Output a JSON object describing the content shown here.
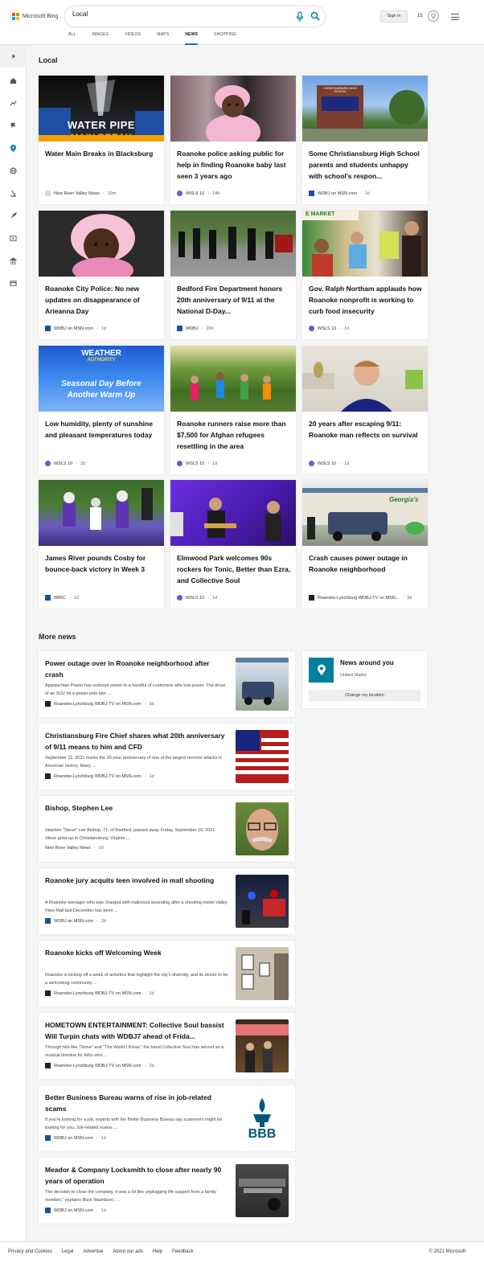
{
  "header": {
    "brand": "Microsoft Bing",
    "search_value": "Local",
    "sign_in": "Sign in",
    "rewards_count": "15"
  },
  "tabs": [
    "ALL",
    "IMAGES",
    "VIDEOS",
    "MAPS",
    "NEWS",
    "SHOPPING"
  ],
  "active_tab": "NEWS",
  "local": {
    "title": "Local",
    "cards": [
      {
        "title": "Water Main Breaks in Blacksburg",
        "source": "New River Valley News",
        "time": "19m"
      },
      {
        "title": "Roanoke police asking public for help in finding Roanoke baby last seen 3 years ago",
        "source": "WSLS 10",
        "time": "14h"
      },
      {
        "title": "Some Christiansburg High School parents and students unhappy with school's respon...",
        "source": "WDBJ on MSN.com",
        "time": "1d"
      },
      {
        "title": "Roanoke City Police: No new updates on disappearance of Arieanna Day",
        "source": "WDBJ on MSN.com",
        "time": "1d"
      },
      {
        "title": "Bedford Fire Department honors 20th anniversary of 9/11 at the National D-Day...",
        "source": "WDBJ",
        "time": "20h"
      },
      {
        "title": "Gov. Ralph Northam applauds how Roanoke nonprofit is working to curb food insecurity",
        "source": "WSLS 10",
        "time": "1d"
      },
      {
        "title": "Low humidity, plenty of sunshine and pleasant temperatures today",
        "source": "WSLS 10",
        "time": "2d"
      },
      {
        "title": "Roanoke runners raise more than $7,500 for Afghan refugees resettling in the area",
        "source": "WSLS 10",
        "time": "1d"
      },
      {
        "title": "20 years after escaping 9/11: Roanoke man reflects on survival",
        "source": "WSLS 10",
        "time": "1d"
      },
      {
        "title": "James River pounds Cosby for bounce-back victory in Week 3",
        "source": "WRIC",
        "time": "1d"
      },
      {
        "title": "Elmwood Park welcomes 90s rockers for Tonic, Better than Ezra, and Collective Soul",
        "source": "WSLS 10",
        "time": "1d"
      },
      {
        "title": "Crash causes power outage in Roanoke neighborhood",
        "source": "Roanoke-Lynchburg WDBJ-TV on MSN...",
        "time": "3d"
      }
    ],
    "card_image_text": {
      "water_line1": "WATER PIPE",
      "water_line2": "MAIN BREAK",
      "weather_brand": "WEATHER",
      "weather_sub": "AUTHORITY",
      "weather_line1": "Seasonal Day Before",
      "weather_line2": "Another Warm Up",
      "sign_text": "CHRISTIANSBURG HIGH SCHOOL",
      "market_text": "E MARKET",
      "store_text": "Georgia's"
    }
  },
  "more_news": {
    "title": "More news",
    "items": [
      {
        "title": "Power outage over in Roanoke neighborhood after crash",
        "snippet": "Appalachian Power has restored power to a handful of customers who lost power. The driver of an SUV hit a power pole late ...",
        "source": "Roanoke-Lynchburg WDBJ-TV on MSN.com",
        "time": "3d"
      },
      {
        "title": "Christiansburg Fire Chief shares what 20th anniversary of 9/11 means to him and CFD",
        "snippet": "September 11, 2021 marks the 20-year anniversary of one of the largest terrorist attacks in American history. Many ...",
        "source": "Roanoke-Lynchburg WDBJ-TV on MSN.com",
        "time": "1d"
      },
      {
        "title": "Bishop, Stephen Lee",
        "snippet": "Stephen \"Steve\" Lee Bishop, 71, of Radford, passed away Friday, September 10, 2021. Steve grew up in Christiansburg, Virginia ...",
        "source": "New River Valley News",
        "time": "1d"
      },
      {
        "title": "Roanoke jury acquits teen involved in mall shooting",
        "snippet": "A Roanoke teenager who was charged with malicious wounding after a shooting inside Valley View Mall last December has been ...",
        "source": "WDBJ on MSN.com",
        "time": "2d"
      },
      {
        "title": "Roanoke kicks off Welcoming Week",
        "snippet": "Roanoke is kicking off a week of activities that highlight the city's diversity, and its desire to be a welcoming community ...",
        "source": "Roanoke-Lynchburg WDBJ-TV on MSN.com",
        "time": "1d"
      },
      {
        "title": "HOMETOWN ENTERTAINMENT: Collective Soul bassist Will Turpin chats with WDBJ7 ahead of Frida...",
        "snippet": "Through hits like \"Shine\" and \"The World I Know,\" the band Collective Soul has served as a musical timeline for folks who ...",
        "source": "Roanoke-Lynchburg WDBJ-TV on MSN.com",
        "time": "2d"
      },
      {
        "title": "Better Business Bureau warns of rise in job-related scams",
        "snippet": "If you're looking for a job, experts with the Better Business Bureau say scammers might be looking for you. Job-related scams ...",
        "source": "WDBJ on MSN.com",
        "time": "1d"
      },
      {
        "title": "Meador & Company Locksmith to close after nearly 90 years of operation",
        "snippet": "The decision to close the company, it was a lot like unplugging life support from a family member,\" explains Buck Washburn, ...",
        "source": "WDBJ on MSN.com",
        "time": "1d"
      }
    ],
    "bbb_text": "BBB"
  },
  "news_around_you": {
    "title": "News around you",
    "location": "United States",
    "button": "Change my location"
  },
  "footer": {
    "links": [
      "Privacy and Cookies",
      "Legal",
      "Advertise",
      "About our ads",
      "Help",
      "Feedback"
    ],
    "copyright": "© 2021 Microsoft"
  },
  "colors": {
    "accent": "#00809d",
    "background": "#f5f5f5"
  }
}
